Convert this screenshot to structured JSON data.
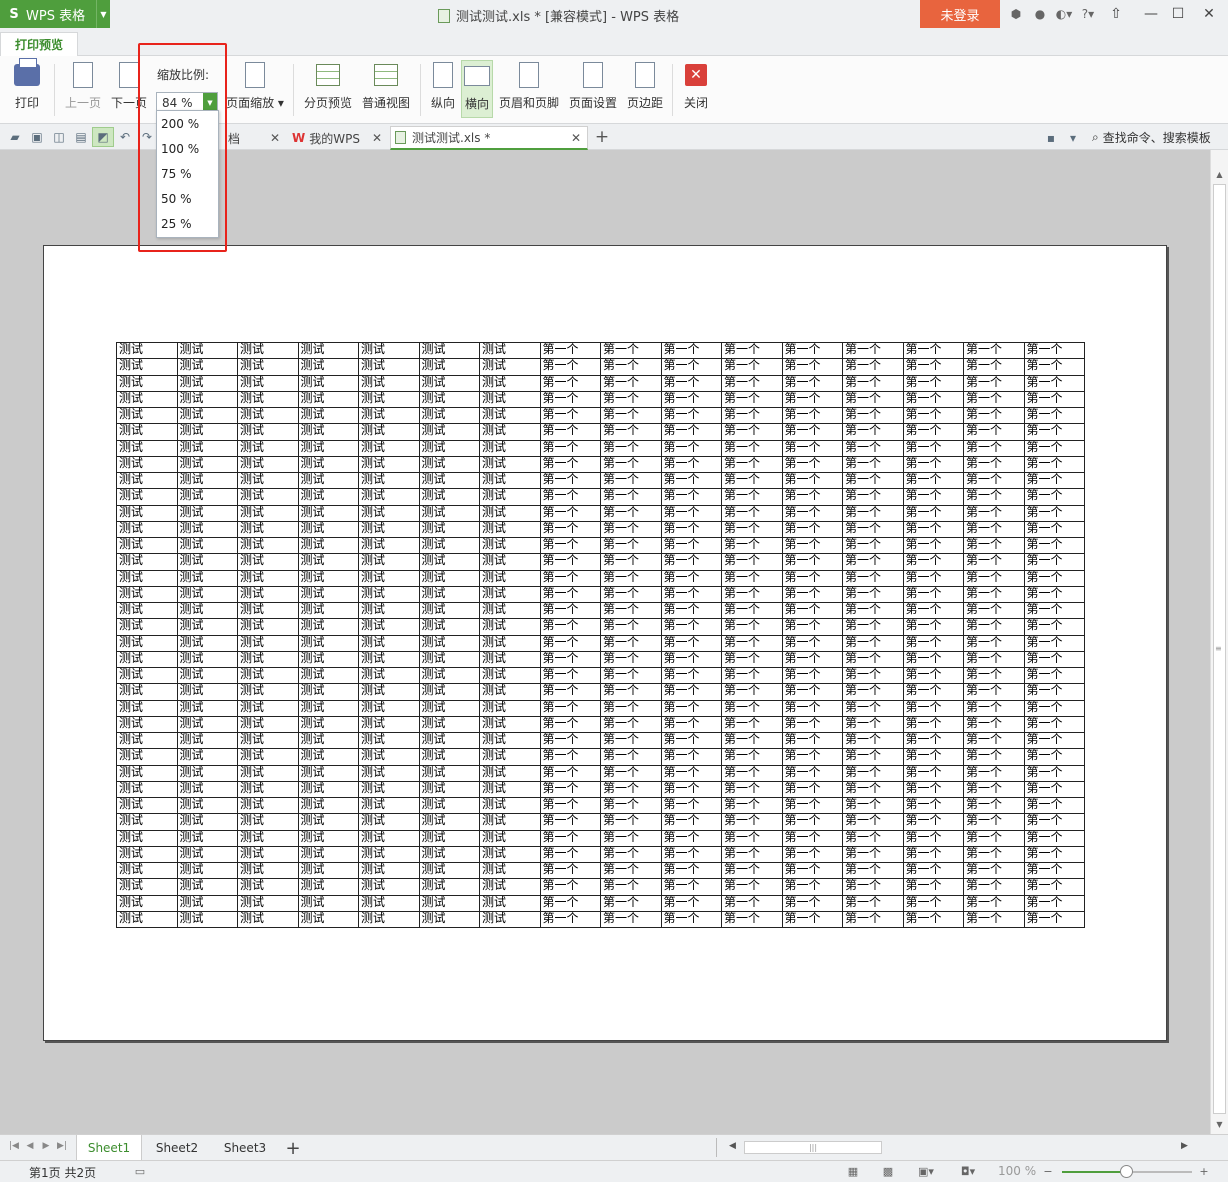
{
  "app": {
    "logo_letter": "S",
    "app_name": "WPS 表格",
    "window_title": "测试测试.xls * [兼容模式] - WPS 表格",
    "login_label": "未登录",
    "help_label": "?"
  },
  "ribbon_tabs": {
    "print_preview": "打印预览"
  },
  "ribbon": {
    "print": "打印",
    "prev_page": "上一页",
    "next_page": "下一页",
    "zoom_label": "缩放比例:",
    "zoom_value": "84 %",
    "page_scale": "页面缩放",
    "page_break_preview": "分页预览",
    "normal_view": "普通视图",
    "portrait": "纵向",
    "landscape": "横向",
    "header_footer": "页眉和页脚",
    "page_setup": "页面设置",
    "margins": "页边距",
    "close": "关闭"
  },
  "zoom_options": [
    "200 %",
    "100 %",
    "75 %",
    "50 %",
    "25 %"
  ],
  "doc_tabs": [
    {
      "label": "档"
    },
    {
      "label": "我的WPS"
    },
    {
      "label": "测试测试.xls *"
    }
  ],
  "search_label": "查找命令、搜索模板",
  "sheet": {
    "col_a_text": "测试",
    "col_b_text": "第一个",
    "cols_a": 7,
    "cols_b": 9,
    "rows": 36
  },
  "sheet_tabs": [
    "Sheet1",
    "Sheet2",
    "Sheet3"
  ],
  "status": {
    "page_info": "第1页 共2页",
    "zoom": "100 %",
    "zoom_fraction": 0.5
  },
  "colors": {
    "accent_green": "#4f9e3d",
    "login_orange": "#e8643e",
    "highlight_red": "#e8231b"
  }
}
